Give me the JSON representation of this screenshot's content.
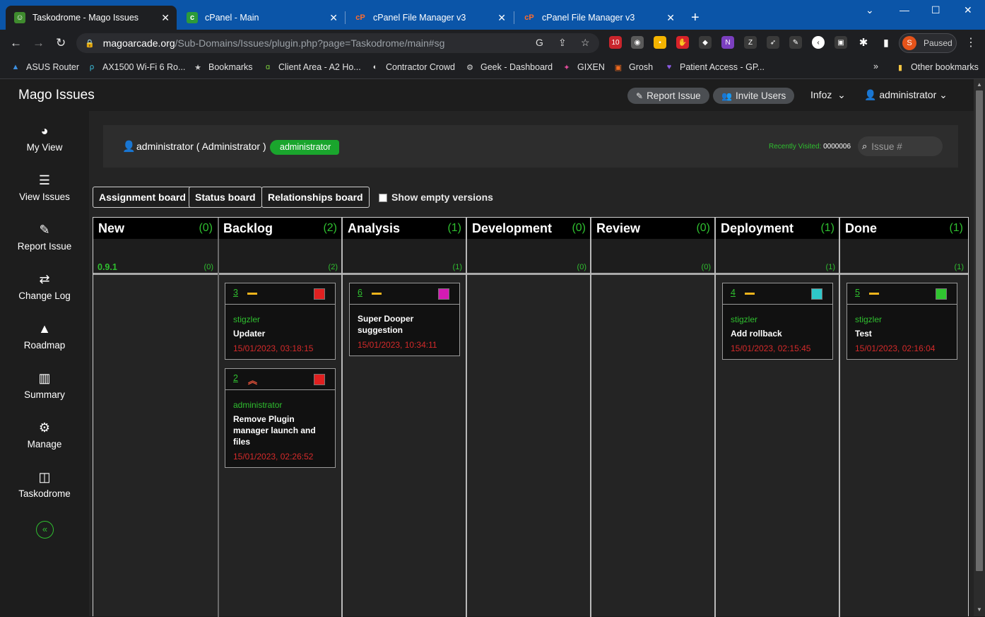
{
  "browser": {
    "tabs": [
      {
        "title": "Taskodrome - Mago Issues",
        "active": true
      },
      {
        "title": "cPanel - Main",
        "active": false
      },
      {
        "title": "cPanel File Manager v3",
        "active": false
      },
      {
        "title": "cPanel File Manager v3",
        "active": false
      }
    ],
    "url_host": "magoarcade.org",
    "url_path": "/Sub-Domains/Issues/plugin.php?page=Taskodrome/main#sg",
    "profile_initial": "S",
    "profile_status": "Paused",
    "ext_badge": "10",
    "bookmarks": [
      "ASUS Router",
      "AX1500 Wi-Fi 6 Ro...",
      "Bookmarks",
      "Client Area - A2 Ho...",
      "Contractor Crowd",
      "Geek - Dashboard",
      "GIXEN",
      "Grosh",
      "Patient Access - GP..."
    ],
    "bookmarks_more": "»",
    "other_bookmarks": "Other bookmarks"
  },
  "app": {
    "brand": "Mago Issues",
    "report_issue": "Report Issue",
    "invite_users": "Invite Users",
    "menu_infoz": "Infoz",
    "menu_user": "administrator",
    "sidebar": [
      {
        "label": "My View",
        "icon": "dashboard-icon"
      },
      {
        "label": "View Issues",
        "icon": "list-icon"
      },
      {
        "label": "Report Issue",
        "icon": "edit-icon"
      },
      {
        "label": "Change Log",
        "icon": "retweet-icon"
      },
      {
        "label": "Roadmap",
        "icon": "road-icon"
      },
      {
        "label": "Summary",
        "icon": "bar-chart-icon"
      },
      {
        "label": "Manage",
        "icon": "gears-icon"
      },
      {
        "label": "Taskodrome",
        "icon": "columns-icon"
      }
    ],
    "user_line": "administrator ( Administrator )",
    "user_badge": "administrator",
    "recently_label": "Recently Visited:",
    "recently_value": "0000006",
    "search_placeholder": "Issue #",
    "boards": [
      "Assignment board",
      "Status board",
      "Relationships board"
    ],
    "show_empty": "Show empty versions",
    "version": "0.9.1",
    "columns": [
      {
        "name": "New",
        "count": "(0)",
        "vcount": "(0)"
      },
      {
        "name": "Backlog",
        "count": "(2)",
        "vcount": "(2)"
      },
      {
        "name": "Analysis",
        "count": "(1)",
        "vcount": "(1)"
      },
      {
        "name": "Development",
        "count": "(0)",
        "vcount": "(0)"
      },
      {
        "name": "Review",
        "count": "(0)",
        "vcount": "(0)"
      },
      {
        "name": "Deployment",
        "count": "(1)",
        "vcount": "(1)"
      },
      {
        "name": "Done",
        "count": "(1)",
        "vcount": "(1)"
      }
    ],
    "cards": [
      {
        "id": "3",
        "priority": "normal",
        "status_color": "#e02020",
        "who": "stigzler",
        "title": "Updater",
        "ts": "15/01/2023, 03:18:15"
      },
      {
        "id": "2",
        "priority": "high",
        "status_color": "#e02020",
        "who": "administrator",
        "title": "Remove Plugin manager launch and files",
        "ts": "15/01/2023, 02:26:52"
      },
      {
        "id": "6",
        "priority": "normal",
        "status_color": "#d41bb4",
        "who": "",
        "title": "Super Dooper suggestion",
        "ts": "15/01/2023, 10:34:11"
      },
      {
        "id": "4",
        "priority": "normal",
        "status_color": "#2ec7c9",
        "who": "stigzler",
        "title": "Add rollback",
        "ts": "15/01/2023, 02:15:45"
      },
      {
        "id": "5",
        "priority": "normal",
        "status_color": "#2fc42f",
        "who": "stigzler",
        "title": "Test",
        "ts": "15/01/2023, 02:16:04"
      }
    ]
  }
}
